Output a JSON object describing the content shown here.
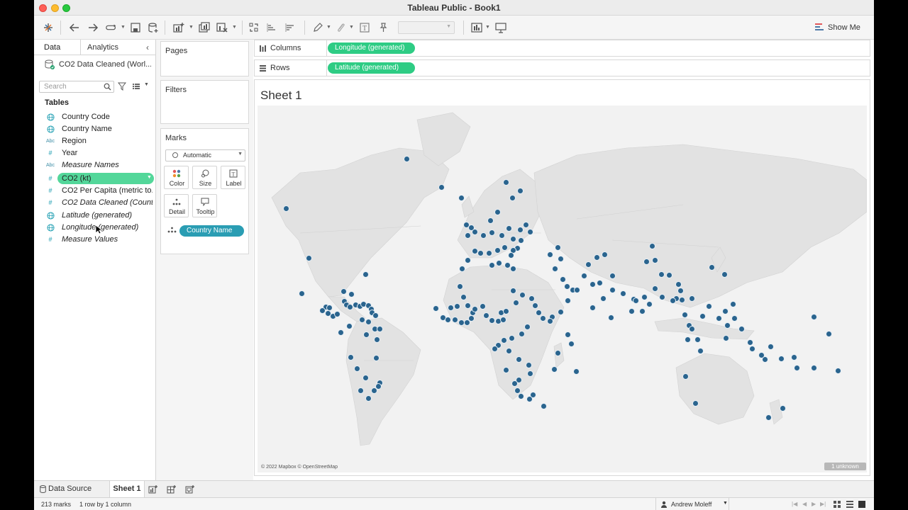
{
  "window": {
    "title": "Tableau Public - Book1"
  },
  "toolbar": {
    "show_me_label": "Show Me",
    "fit_value": ""
  },
  "data_pane": {
    "tab_data": "Data",
    "tab_analytics": "Analytics",
    "datasource_name": "CO2 Data Cleaned (Worl...",
    "search_placeholder": "Search",
    "tables_header": "Tables",
    "fields": [
      {
        "label": "Country Code",
        "icon": "globe-icon",
        "italic": false
      },
      {
        "label": "Country Name",
        "icon": "globe-icon",
        "italic": false
      },
      {
        "label": "Region",
        "icon": "abc-icon",
        "italic": false
      },
      {
        "label": "Year",
        "icon": "hash-icon",
        "italic": false
      },
      {
        "label": "Measure Names",
        "icon": "abc-icon",
        "italic": true
      },
      {
        "label": "CO2 (kt)",
        "icon": "hash-icon",
        "italic": false,
        "selected": true
      },
      {
        "label": "CO2 Per Capita (metric to...",
        "icon": "hash-icon",
        "italic": false
      },
      {
        "label": "CO2 Data Cleaned (Count)",
        "icon": "hash-icon",
        "italic": true
      },
      {
        "label": "Latitude (generated)",
        "icon": "globe-icon",
        "italic": true
      },
      {
        "label": "Longitude (generated)",
        "icon": "globe-icon",
        "italic": true
      },
      {
        "label": "Measure Values",
        "icon": "hash-icon",
        "italic": true
      }
    ]
  },
  "cards": {
    "pages": "Pages",
    "filters": "Filters",
    "marks": "Marks",
    "mark_type": "Automatic",
    "mark_buttons": [
      "Color",
      "Size",
      "Label",
      "Detail",
      "Tooltip"
    ],
    "detail_field": "Country Name"
  },
  "shelves": {
    "columns_label": "Columns",
    "columns_pill": "Longitude (generated)",
    "rows_label": "Rows",
    "rows_pill": "Latitude (generated)"
  },
  "view": {
    "sheet_title": "Sheet 1",
    "attribution": "© 2022 Mapbox © OpenStreetMap",
    "unknown_badge": "1 unknown",
    "mark_color": "#2a648e"
  },
  "bottom_tabs": {
    "data_source": "Data Source",
    "sheet": "Sheet 1"
  },
  "status": {
    "marks": "213 marks",
    "dims": "1 row by 1 column",
    "user": "Andrew Moleff"
  },
  "colors": {
    "pill_green": "#2ecc84",
    "pill_teal": "#2a9db3",
    "selected_field": "#53d79a"
  }
}
